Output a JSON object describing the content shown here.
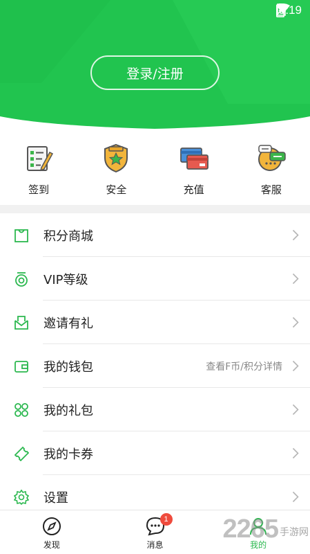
{
  "status_bar": {
    "time": "9:19",
    "icons": [
      "wifi-icon",
      "no-sim-icon",
      "battery-charging-icon"
    ]
  },
  "header": {
    "login_label": "登录/注册",
    "brand_color": "#21c44f"
  },
  "quick_actions": [
    {
      "label": "签到",
      "icon": "sign-in-clipboard-icon"
    },
    {
      "label": "安全",
      "icon": "security-badge-icon"
    },
    {
      "label": "充值",
      "icon": "recharge-card-icon"
    },
    {
      "label": "客服",
      "icon": "customer-service-icon"
    }
  ],
  "menu": [
    {
      "label": "积分商城",
      "icon": "shopping-bag-icon",
      "extra": ""
    },
    {
      "label": "VIP等级",
      "icon": "vip-medal-icon",
      "extra": ""
    },
    {
      "label": "邀请有礼",
      "icon": "invite-mail-icon",
      "extra": ""
    },
    {
      "label": "我的钱包",
      "icon": "wallet-icon",
      "extra": "查看F币/积分详情"
    },
    {
      "label": "我的礼包",
      "icon": "gift-pack-icon",
      "extra": ""
    },
    {
      "label": "我的卡券",
      "icon": "ticket-icon",
      "extra": ""
    },
    {
      "label": "设置",
      "icon": "settings-gear-icon",
      "extra": ""
    }
  ],
  "bottom_nav": [
    {
      "label": "发现",
      "icon": "compass-icon",
      "active": false
    },
    {
      "label": "消息",
      "icon": "message-icon",
      "active": false,
      "badge": "1"
    },
    {
      "label": "我的",
      "icon": "profile-icon",
      "active": true
    }
  ],
  "watermark": {
    "number": "2265",
    "text": "手游网"
  },
  "colors": {
    "accent": "#2bb84f",
    "badge": "#ef4b3d",
    "divider": "#e8e8e8"
  }
}
